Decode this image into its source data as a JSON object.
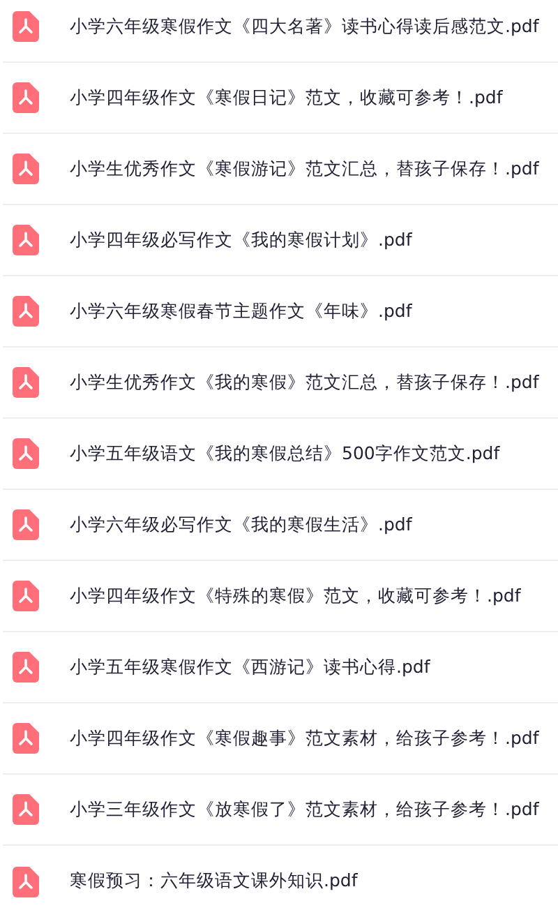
{
  "files": [
    {
      "name": "小学六年级寒假作文《四大名著》读书心得读后感范文.pdf"
    },
    {
      "name": "小学四年级作文《寒假日记》范文，收藏可参考！.pdf"
    },
    {
      "name": "小学生优秀作文《寒假游记》范文汇总，替孩子保存！.pdf"
    },
    {
      "name": "小学四年级必写作文《我的寒假计划》.pdf"
    },
    {
      "name": "小学六年级寒假春节主题作文《年味》.pdf"
    },
    {
      "name": "小学生优秀作文《我的寒假》范文汇总，替孩子保存！.pdf"
    },
    {
      "name": "小学五年级语文《我的寒假总结》500字作文范文.pdf"
    },
    {
      "name": "小学六年级必写作文《我的寒假生活》.pdf"
    },
    {
      "name": "小学四年级作文《特殊的寒假》范文，收藏可参考！.pdf"
    },
    {
      "name": "小学五年级寒假作文《西游记》读书心得.pdf"
    },
    {
      "name": "小学四年级作文《寒假趣事》范文素材，给孩子参考！.pdf"
    },
    {
      "name": "小学三年级作文《放寒假了》范文素材，给孩子参考！.pdf"
    },
    {
      "name": "寒假预习：六年级语文课外知识.pdf"
    }
  ]
}
